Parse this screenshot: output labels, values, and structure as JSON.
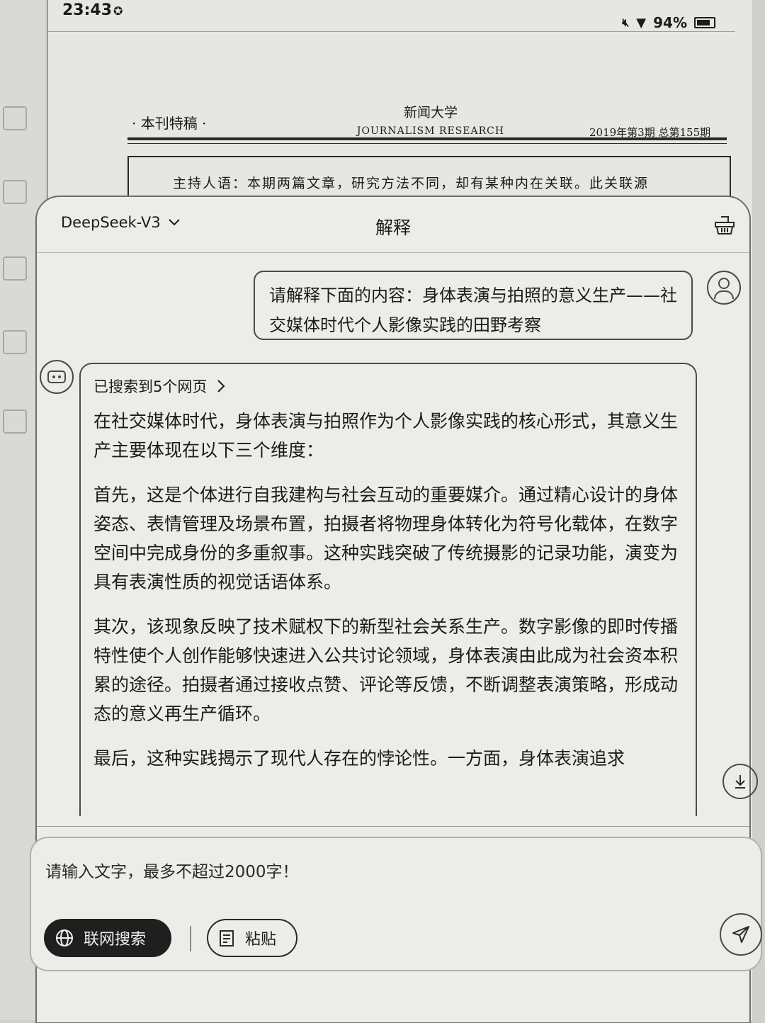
{
  "status": {
    "time": "23:43",
    "battery": "94%"
  },
  "journal": {
    "column": "· 本刊特稿 ·",
    "name_cn": "新闻大学",
    "name_en": "JOURNALISM RESEARCH",
    "issue": "2019年第3期 总第155期",
    "host_line": "主持人语：本期两篇文章，研究方法不同，却有某种内在关联。此关联源"
  },
  "panel": {
    "model": "DeepSeek-V3",
    "title": "解释"
  },
  "user_message": "请解释下面的内容：身体表演与拍照的意义生产——社交媒体时代个人影像实践的田野考察",
  "bot": {
    "search_label": "已搜索到5个网页",
    "paragraphs": [
      "在社交媒体时代，身体表演与拍照作为个人影像实践的核心形式，其意义生产主要体现在以下三个维度：",
      "首先，这是个体进行自我建构与社会互动的重要媒介。通过精心设计的身体姿态、表情管理及场景布置，拍摄者将物理身体转化为符号化载体，在数字空间中完成身份的多重叙事。这种实践突破了传统摄影的记录功能，演变为具有表演性质的视觉话语体系。",
      "其次，该现象反映了技术赋权下的新型社会关系生产。数字影像的即时传播特性使个人创作能够快速进入公共讨论领域，身体表演由此成为社会资本积累的途径。拍摄者通过接收点赞、评论等反馈，不断调整表演策略，形成动态的意义再生产循环。",
      "最后，这种实践揭示了现代人存在的悖论性。一方面，身体表演追求"
    ]
  },
  "input": {
    "placeholder": "请输入文字，最多不超过2000字！",
    "web_search_label": "联网搜索",
    "paste_label": "粘贴"
  }
}
